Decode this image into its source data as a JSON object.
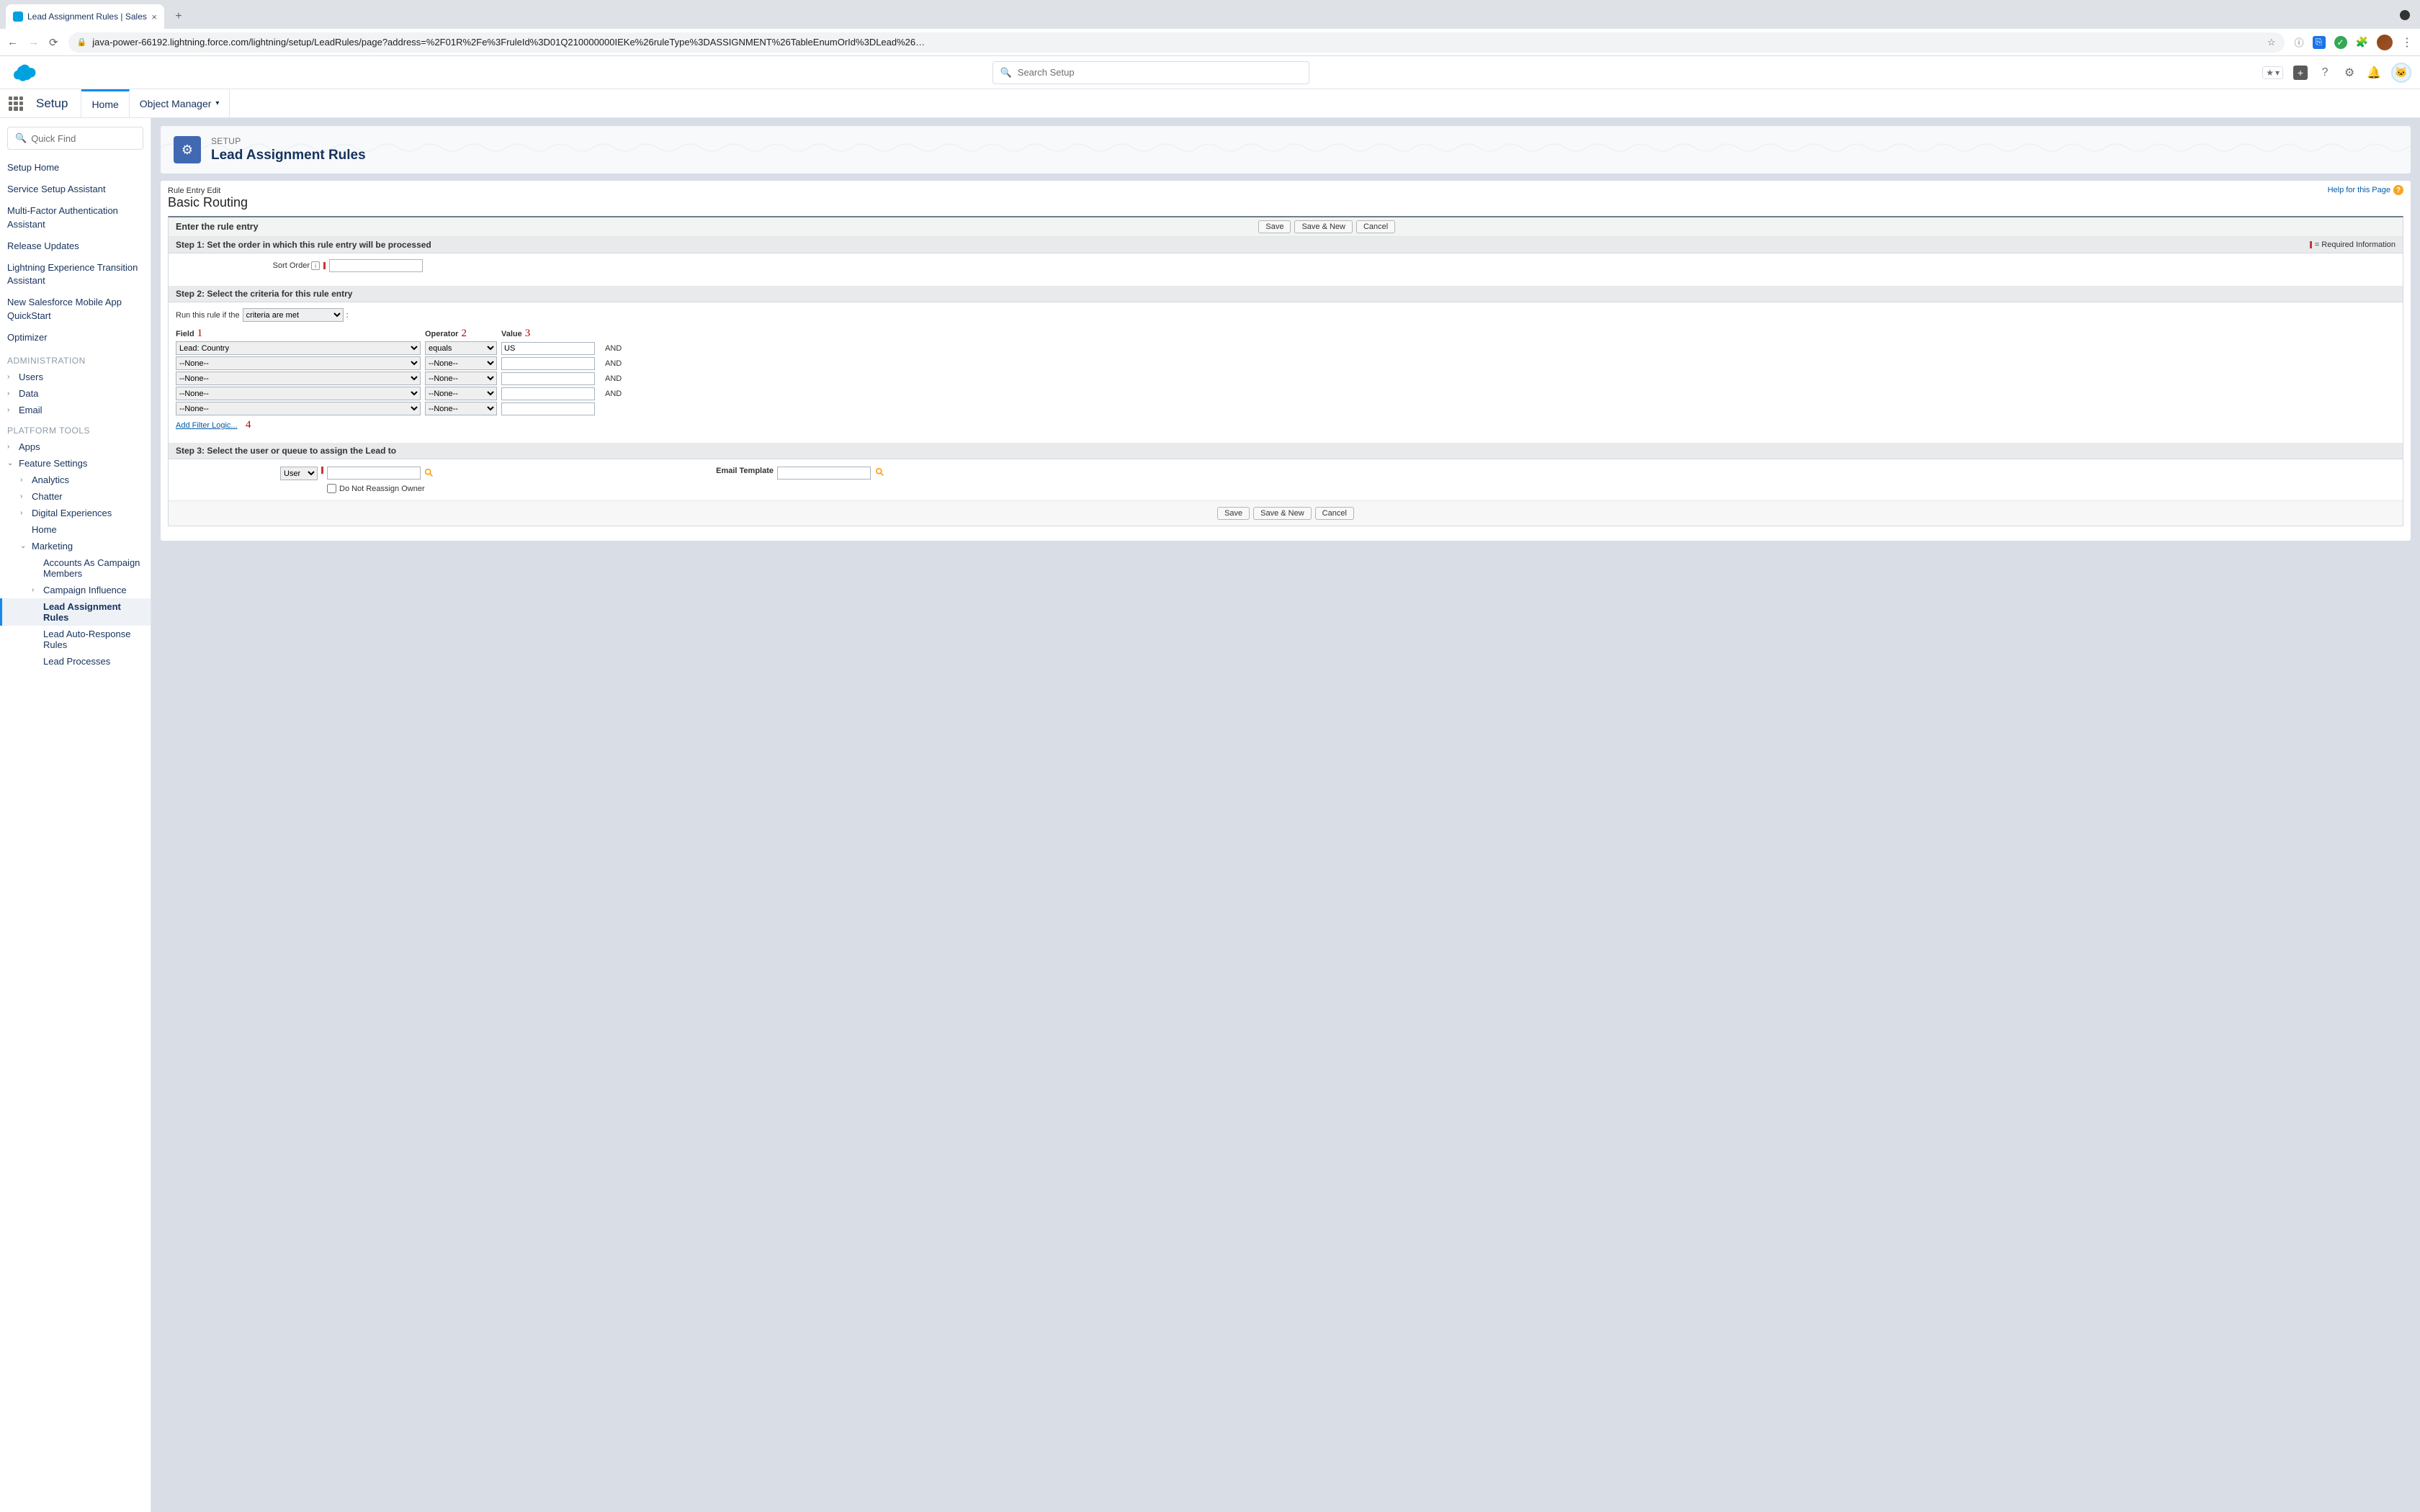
{
  "browser": {
    "tab_title": "Lead Assignment Rules | Sales",
    "url": "java-power-66192.lightning.force.com/lightning/setup/LeadRules/page?address=%2F01R%2Fe%3FruleId%3D01Q210000000IEKe%26ruleType%3DASSIGNMENT%26TableEnumOrId%3DLead%26…"
  },
  "header": {
    "search_placeholder": "Search Setup"
  },
  "setupbar": {
    "title": "Setup",
    "tab_home": "Home",
    "tab_objmgr": "Object Manager"
  },
  "sidebar": {
    "quickfind": "Quick Find",
    "links": [
      "Setup Home",
      "Service Setup Assistant",
      "Multi-Factor Authentication Assistant",
      "Release Updates",
      "Lightning Experience Transition Assistant",
      "New Salesforce Mobile App QuickStart",
      "Optimizer"
    ],
    "section_admin": "ADMINISTRATION",
    "admin_items": [
      "Users",
      "Data",
      "Email"
    ],
    "section_platform": "PLATFORM TOOLS",
    "apps": "Apps",
    "feature": "Feature Settings",
    "feature_children": [
      "Analytics",
      "Chatter",
      "Digital Experiences",
      "Home"
    ],
    "marketing": "Marketing",
    "marketing_children": [
      "Accounts As Campaign Members",
      "Campaign Influence",
      "Lead Assignment Rules",
      "Lead Auto-Response Rules",
      "Lead Processes"
    ]
  },
  "pagehead": {
    "eyebrow": "SETUP",
    "title": "Lead Assignment Rules"
  },
  "classic": {
    "crumb": "Rule Entry Edit",
    "title": "Basic Routing",
    "help": "Help for this Page",
    "enter_rule": "Enter the rule entry",
    "btn_save": "Save",
    "btn_savenew": "Save & New",
    "btn_cancel": "Cancel",
    "step1": "Step 1: Set the order in which this rule entry will be processed",
    "req_info": "= Required Information",
    "sort_order": "Sort Order",
    "step2": "Step 2: Select the criteria for this rule entry",
    "run_if": "Run this rule if the",
    "run_if_val": "criteria are met",
    "col_field": "Field",
    "col_op": "Operator",
    "col_val": "Value",
    "annot1": "1",
    "annot2": "2",
    "annot3": "3",
    "annot4": "4",
    "rows": [
      {
        "field": "Lead: Country",
        "op": "equals",
        "val": "US",
        "and": "AND"
      },
      {
        "field": "--None--",
        "op": "--None--",
        "val": "",
        "and": "AND"
      },
      {
        "field": "--None--",
        "op": "--None--",
        "val": "",
        "and": "AND"
      },
      {
        "field": "--None--",
        "op": "--None--",
        "val": "",
        "and": "AND"
      },
      {
        "field": "--None--",
        "op": "--None--",
        "val": "",
        "and": ""
      }
    ],
    "add_filter": "Add Filter Logic...",
    "step3": "Step 3: Select the user or queue to assign the Lead to",
    "assignee_type": "User",
    "no_reassign": "Do Not Reassign Owner",
    "email_tmpl": "Email Template"
  }
}
